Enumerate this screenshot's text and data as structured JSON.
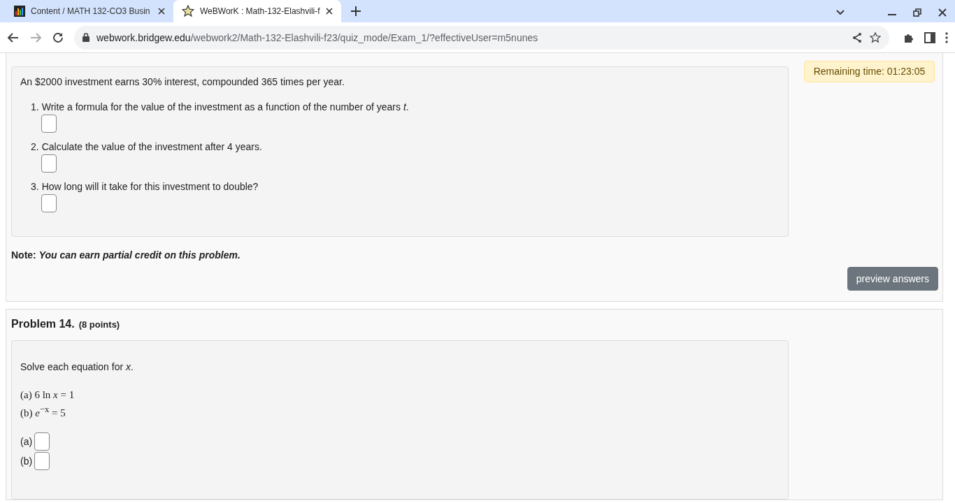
{
  "browser": {
    "tabs": [
      {
        "title": "Content / MATH 132-CO3 Busin",
        "kind": "chart",
        "selected": false
      },
      {
        "title": "WeBWorK : Math-132-Elashvili-f",
        "kind": "star",
        "selected": true
      }
    ],
    "url_host": "webwork.bridgew.edu",
    "url_path": "/webwork2/Math-132-Elashvili-f23/quiz_mode/Exam_1/?effectiveUser=m5nunes"
  },
  "timer": "Remaining time: 01:23:05",
  "problems": [
    {
      "intro": "An $2000 investment earns 30% interest, compounded 365 times per year.",
      "parts": [
        {
          "number": "1.",
          "text": "Write a formula for the value of the investment as a function of the number of years *t*."
        },
        {
          "number": "2.",
          "text": "Calculate the value of the investment after 4 years."
        },
        {
          "number": "3.",
          "text": "How long will it take for this investment to double?"
        }
      ],
      "note": "Note: *You can earn partial credit on this problem.*",
      "button": "preview answers"
    },
    {
      "title": "Problem 14.",
      "points": "(8 points)",
      "intro": "Solve each equation for *x*.",
      "equations": [
        "(a) 6 ln *x* = 1",
        "(b) *e*$^{−x}$ = 5"
      ],
      "answers": [
        {
          "label": "(a)"
        },
        {
          "label": "(b)"
        }
      ]
    }
  ]
}
